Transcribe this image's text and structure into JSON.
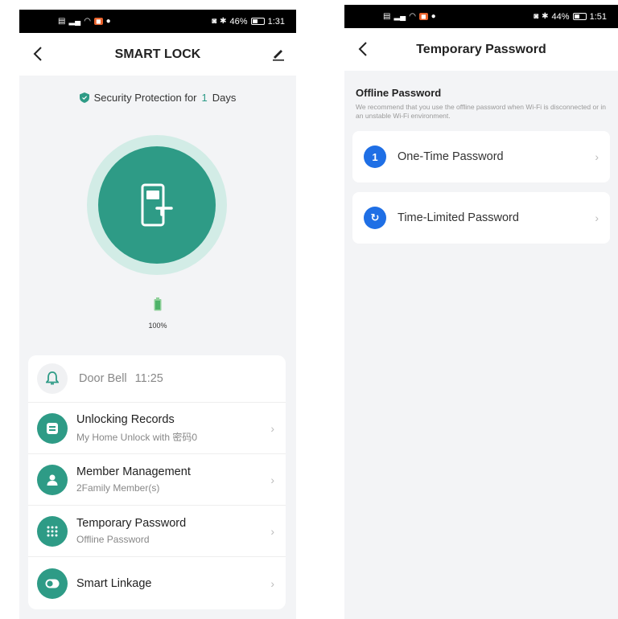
{
  "left": {
    "statusbar": {
      "battery": "46%",
      "time": "1:31"
    },
    "title": "SMART LOCK",
    "security": {
      "prefix": "Security Protection for",
      "days": "1",
      "suffix": "Days"
    },
    "battery_percent": "100%",
    "doorbell": {
      "label": "Door Bell",
      "time": "11:25"
    },
    "items": [
      {
        "title": "Unlocking Records",
        "subtitle": "My Home Unlock with 密码0"
      },
      {
        "title": "Member Management",
        "subtitle": "2Family Member(s)"
      },
      {
        "title": "Temporary Password",
        "subtitle": "Offline Password"
      },
      {
        "title": "Smart Linkage",
        "subtitle": ""
      }
    ]
  },
  "right": {
    "statusbar": {
      "battery": "44%",
      "time": "1:51"
    },
    "title": "Temporary Password",
    "section_title": "Offline Password",
    "section_desc": "We recommend that you use the offline password when Wi-Fi is disconnected or in an unstable Wi-Fi environment.",
    "options": [
      {
        "icon_text": "1",
        "label": "One-Time Password"
      },
      {
        "icon_text": "↻",
        "label": "Time-Limited Password"
      }
    ]
  },
  "colors": {
    "accent": "#2e9b86",
    "accent_light": "#d2ece6",
    "blue": "#1f6fe5"
  },
  "icons": [
    "back-arrow-icon",
    "edit-icon",
    "shield-icon",
    "door-lock-icon",
    "battery-icon",
    "bell-icon",
    "records-icon",
    "member-icon",
    "keypad-icon",
    "toggle-icon",
    "chevron-right-icon"
  ]
}
